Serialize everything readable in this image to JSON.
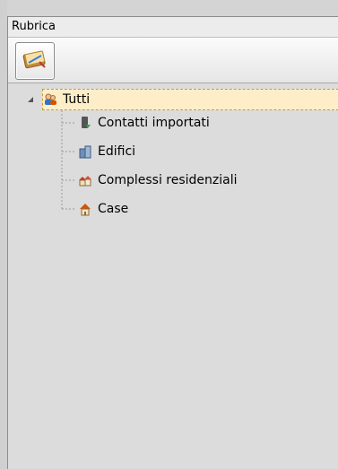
{
  "panel": {
    "title": "Rubrica"
  },
  "toolbar": {
    "button_icon": "address-book-icon"
  },
  "tree": {
    "root": {
      "label": "Tutti",
      "icon": "users-icon",
      "expanded": true
    },
    "children": [
      {
        "label": "Contatti importati",
        "icon": "import-contacts-icon"
      },
      {
        "label": "Edifici",
        "icon": "buildings-icon"
      },
      {
        "label": "Complessi residenziali",
        "icon": "residential-complex-icon"
      },
      {
        "label": "Case",
        "icon": "house-icon"
      }
    ]
  }
}
